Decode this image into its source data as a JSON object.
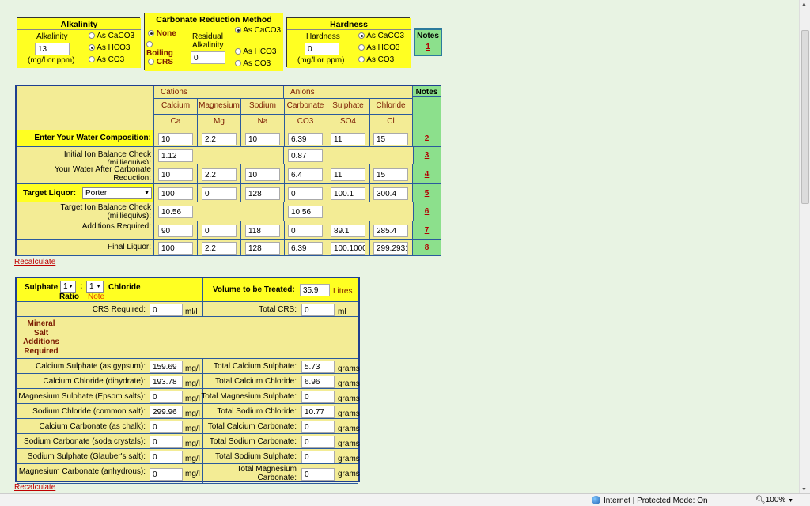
{
  "alkalinity": {
    "title": "Alkalinity",
    "label": "Alkalinity",
    "value": "13",
    "unit": "(mg/l or ppm)",
    "options": [
      "As CaCO3",
      "As HCO3",
      "As CO3"
    ],
    "selected_index": 1
  },
  "carbonate": {
    "title": "Carbonate Reduction Method",
    "opt_none": "None",
    "opt_boiling": "Boiling",
    "opt_crs": "CRS",
    "residual_label": "Residual Alkalinity",
    "residual_value": "0",
    "options": [
      "As CaCO3",
      "As HCO3",
      "As CO3"
    ],
    "selected_index": 0
  },
  "hardness": {
    "title": "Hardness",
    "label": "Hardness",
    "value": "0",
    "unit": "(mg/l or ppm)",
    "options": [
      "As CaCO3",
      "As HCO3",
      "As CO3"
    ],
    "selected_index": 0
  },
  "notes_top": {
    "title": "Notes",
    "link": "1"
  },
  "main_table": {
    "cations_header": "Cations",
    "anions_header": "Anions",
    "notes_header": "Notes",
    "ions": [
      {
        "name": "Calcium",
        "symbol": "Ca"
      },
      {
        "name": "Magnesium",
        "symbol": "Mg"
      },
      {
        "name": "Sodium",
        "symbol": "Na"
      },
      {
        "name": "Carbonate",
        "symbol": "CO3"
      },
      {
        "name": "Sulphate",
        "symbol": "SO4"
      },
      {
        "name": "Chloride",
        "symbol": "Cl"
      }
    ],
    "rows": [
      {
        "label": "Enter Your Water Composition:",
        "values": [
          "10",
          "2.2",
          "10",
          "6.39",
          "11",
          "15"
        ],
        "note": "2"
      },
      {
        "label": "Initial Ion Balance Check (milliequivs):",
        "values": [
          "1.12",
          "",
          "",
          "0.87",
          "",
          ""
        ],
        "note": "3"
      },
      {
        "label": "Your Water After Carbonate Reduction:",
        "values": [
          "10",
          "2.2",
          "10",
          "6.4",
          "11",
          "15"
        ],
        "note": "4"
      },
      {
        "label": "Target Liquor:",
        "values": [
          "100",
          "0",
          "128",
          "0",
          "100.1",
          "300.4"
        ],
        "note": "5"
      },
      {
        "label": "Target Ion Balance Check (milliequivs):",
        "values": [
          "10.56",
          "",
          "",
          "10.56",
          "",
          ""
        ],
        "note": "6"
      },
      {
        "label": "Additions Required:",
        "values": [
          "90",
          "0",
          "118",
          "0",
          "89.1",
          "285.4"
        ],
        "note": "7"
      },
      {
        "label": "Final Liquor:",
        "values": [
          "100",
          "2.2",
          "128",
          "6.39",
          "100.1000",
          "299.2931"
        ],
        "note": "8"
      }
    ],
    "target_select": "Porter"
  },
  "recalculate_1": "Recalculate",
  "salts": {
    "sulphate_label": "Sulphate",
    "ratio_label": "Ratio",
    "ratio_left": "1",
    "ratio_sep": ":",
    "ratio_right": "1",
    "chloride_label": "Chloride",
    "note_link": "Note",
    "volume_label": "Volume to be Treated:",
    "volume_value": "35.9",
    "volume_unit": "Litres",
    "crs_label": "CRS Required:",
    "crs_value": "0",
    "crs_unit": "ml/l",
    "total_crs_label": "Total CRS:",
    "total_crs_value": "0",
    "total_crs_unit": "ml",
    "mineral_header": "Mineral Salt Additions Required",
    "rows": [
      {
        "label": "Calcium Sulphate (as gypsum):",
        "value": "159.69",
        "unit": "mg/l",
        "total_label": "Total Calcium Sulphate:",
        "total": "5.73",
        "total_unit": "grams"
      },
      {
        "label": "Calcium Chloride (dihydrate):",
        "value": "193.78",
        "unit": "mg/l",
        "total_label": "Total Calcium Chloride:",
        "total": "6.96",
        "total_unit": "grams"
      },
      {
        "label": "Magnesium Sulphate (Epsom salts):",
        "value": "0",
        "unit": "mg/l",
        "total_label": "Total Magnesium Sulphate:",
        "total": "0",
        "total_unit": "grams"
      },
      {
        "label": "Sodium Chloride (common salt):",
        "value": "299.96",
        "unit": "mg/l",
        "total_label": "Total Sodium Chloride:",
        "total": "10.77",
        "total_unit": "grams"
      },
      {
        "label": "Calcium Carbonate (as chalk):",
        "value": "0",
        "unit": "mg/l",
        "total_label": "Total Calcium Carbonate:",
        "total": "0",
        "total_unit": "grams"
      },
      {
        "label": "Sodium Carbonate (soda crystals):",
        "value": "0",
        "unit": "mg/l",
        "total_label": "Total Sodium Carbonate:",
        "total": "0",
        "total_unit": "grams"
      },
      {
        "label": "Sodium Sulphate (Glauber's salt):",
        "value": "0",
        "unit": "mg/l",
        "total_label": "Total Sodium Sulphate:",
        "total": "0",
        "total_unit": "grams"
      },
      {
        "label": "Magnesium Carbonate (anhydrous):",
        "value": "0",
        "unit": "mg/l",
        "total_label": "Total Magnesium Carbonate:",
        "total": "0",
        "total_unit": "grams"
      }
    ]
  },
  "recalculate_2": "Recalculate",
  "status": {
    "zone": "Internet | Protected Mode: On",
    "zoom": "100%"
  }
}
